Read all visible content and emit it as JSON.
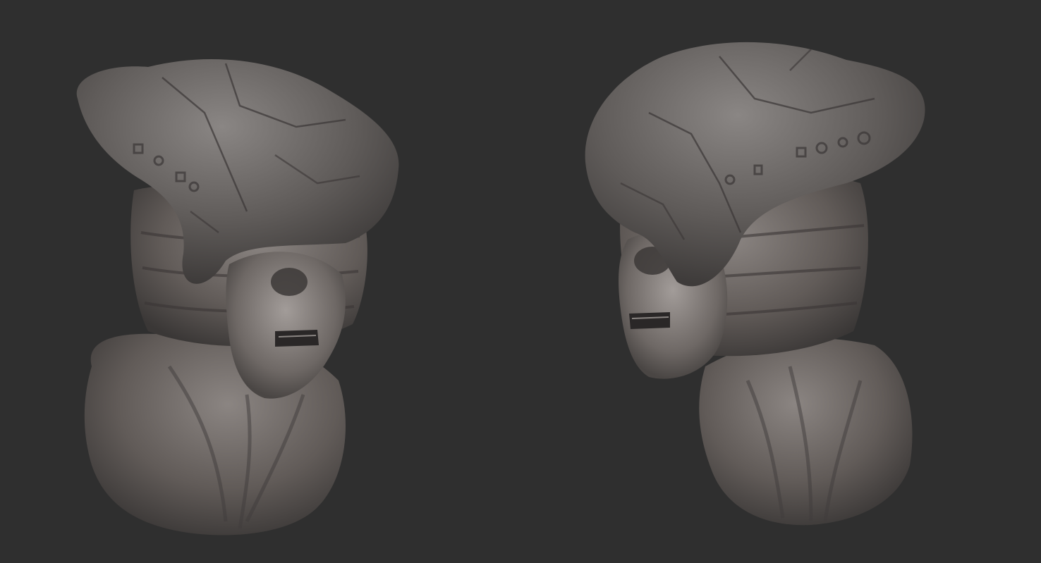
{
  "scene": {
    "background_color": "#2f2f2f",
    "material_color": "#6f6b69",
    "views": [
      {
        "name": "left-three-quarter-view"
      },
      {
        "name": "right-three-quarter-view"
      }
    ]
  }
}
